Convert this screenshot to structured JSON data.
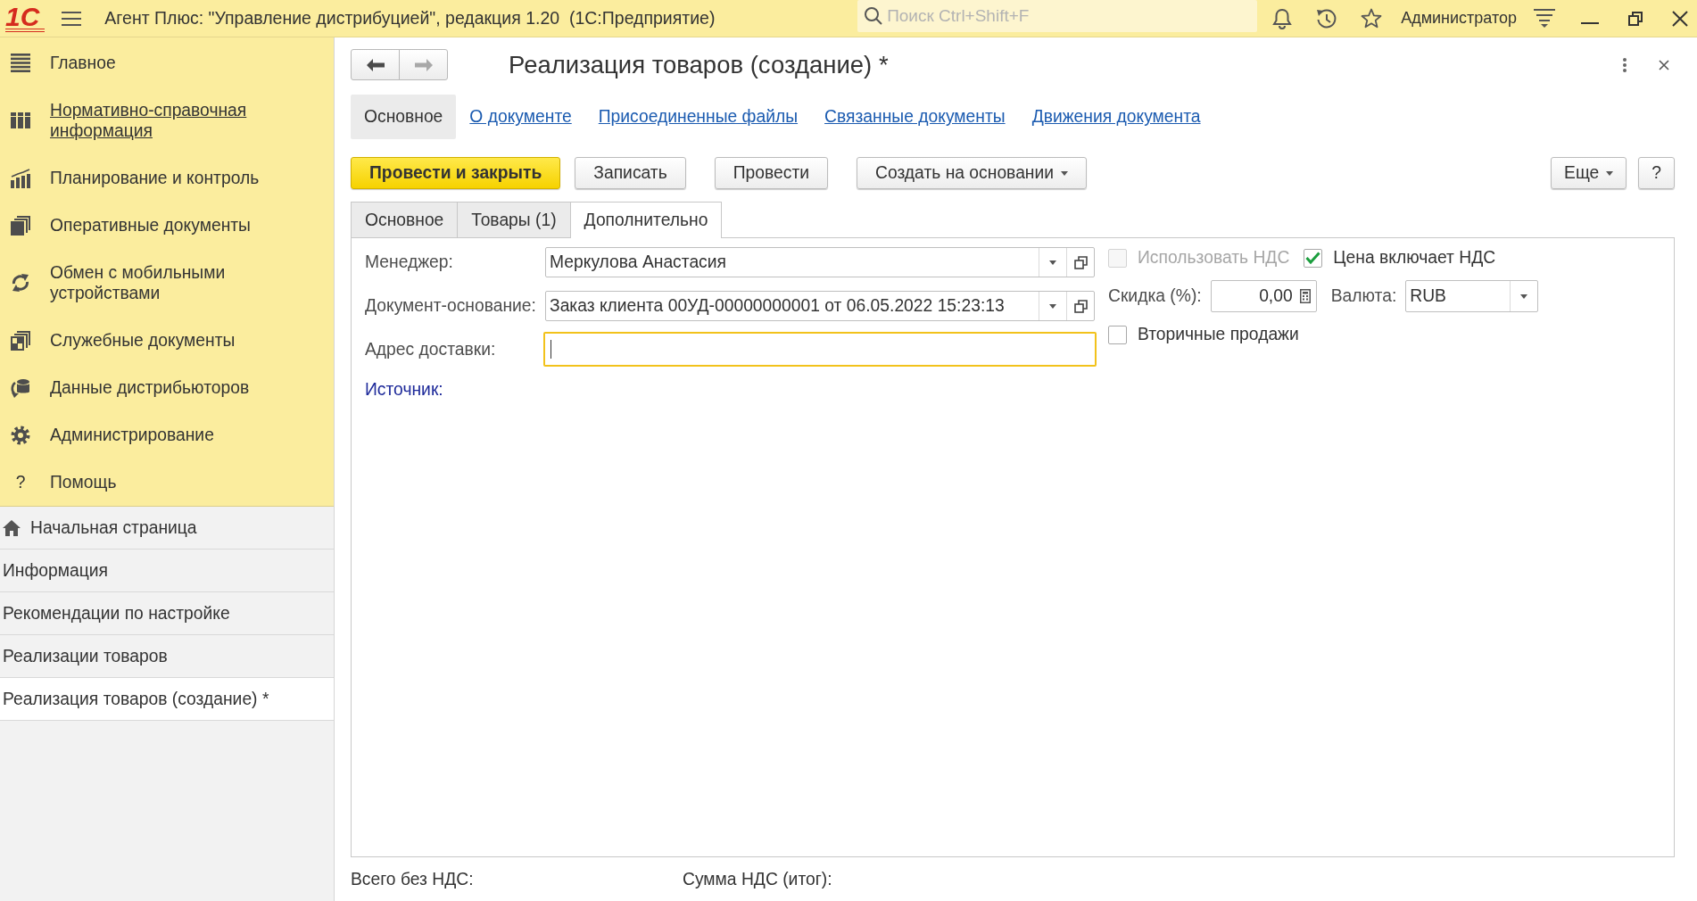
{
  "window": {
    "logo": "1С",
    "title": "Агент Плюс: \"Управление дистрибуцией\", редакция 1.20  (1С:Предприятие)"
  },
  "top_bar": {
    "search": {
      "placeholder": "Поиск Ctrl+Shift+F"
    },
    "user": "Администратор"
  },
  "sidebar": {
    "sections": [
      {
        "label": "Главное",
        "hovered": false
      },
      {
        "label": "Нормативно-справочная информация",
        "hovered": true
      },
      {
        "label": "Планирование и контроль",
        "hovered": false
      },
      {
        "label": "Оперативные документы",
        "hovered": false
      },
      {
        "label": "Обмен с мобильными устройствами",
        "hovered": false
      },
      {
        "label": "Служебные документы",
        "hovered": false
      },
      {
        "label": "Данные дистрибьюторов",
        "hovered": false
      },
      {
        "label": "Администрирование",
        "hovered": false
      },
      {
        "label": "Помощь",
        "glyph": "?",
        "hovered": false
      }
    ],
    "open_windows": [
      {
        "kind": "home",
        "label": "Начальная страница",
        "selected": false
      },
      {
        "kind": "page",
        "label": "Информация",
        "selected": false
      },
      {
        "kind": "page",
        "label": "Рекомендации по настройке",
        "selected": false
      },
      {
        "kind": "page",
        "label": "Реализации товаров",
        "selected": false
      },
      {
        "kind": "page",
        "label": "Реализация товаров (создание) *",
        "selected": true
      }
    ]
  },
  "form": {
    "nav": {
      "back_disabled": false,
      "forward_disabled": true
    },
    "title": "Реализация товаров (создание) *",
    "nav_tabs": [
      {
        "label": "Основное",
        "selected": true
      },
      {
        "label": "О документе",
        "selected": false
      },
      {
        "label": "Присоединенные файлы",
        "selected": false
      },
      {
        "label": "Связанные документы",
        "selected": false
      },
      {
        "label": "Движения документа",
        "selected": false
      }
    ],
    "buttons": [
      {
        "kind": "primary",
        "label": "Провести и закрыть"
      },
      {
        "kind": "plain",
        "label": "Записать"
      },
      {
        "kind": "plain",
        "label": "Провести"
      },
      {
        "kind": "menu",
        "label": "Создать на основании"
      }
    ],
    "aux_buttons": [
      {
        "kind": "menu",
        "label": "Еще"
      },
      {
        "kind": "plain",
        "label": "?"
      }
    ],
    "page_tabs": [
      {
        "label": "Основное",
        "selected": false
      },
      {
        "label": "Товары (1)",
        "selected": false
      },
      {
        "label": "Дополнительно",
        "selected": true
      }
    ],
    "fields": [
      {
        "kind": "select",
        "label": "Менеджер:",
        "value": "Меркулова Анастасия",
        "focused": false
      },
      {
        "kind": "select",
        "label": "Документ-основание:",
        "value": "Заказ клиента 00УД-00000000001 от 06.05.2022 15:23:13",
        "focused": false
      },
      {
        "kind": "text",
        "label": "Адрес доставки:",
        "focused": true
      }
    ],
    "source_label": "Источник:",
    "options_rows": [
      [
        {
          "kind": "checkbox",
          "label": "Использовать НДС",
          "checked": false,
          "disabled": true
        },
        {
          "kind": "checkbox",
          "label": "Цена включает НДС",
          "checked": true,
          "disabled": false
        }
      ],
      [
        {
          "kind": "number",
          "label": "Скидка (%):",
          "value": "0,00"
        },
        {
          "kind": "select",
          "label": "Валюта:",
          "value": "RUB"
        }
      ],
      [
        {
          "kind": "checkbox",
          "label": "Вторичные продажи",
          "checked": false,
          "disabled": false
        }
      ]
    ]
  },
  "totals": [
    "Всего без НДС:",
    "Сумма НДС (итог):"
  ]
}
